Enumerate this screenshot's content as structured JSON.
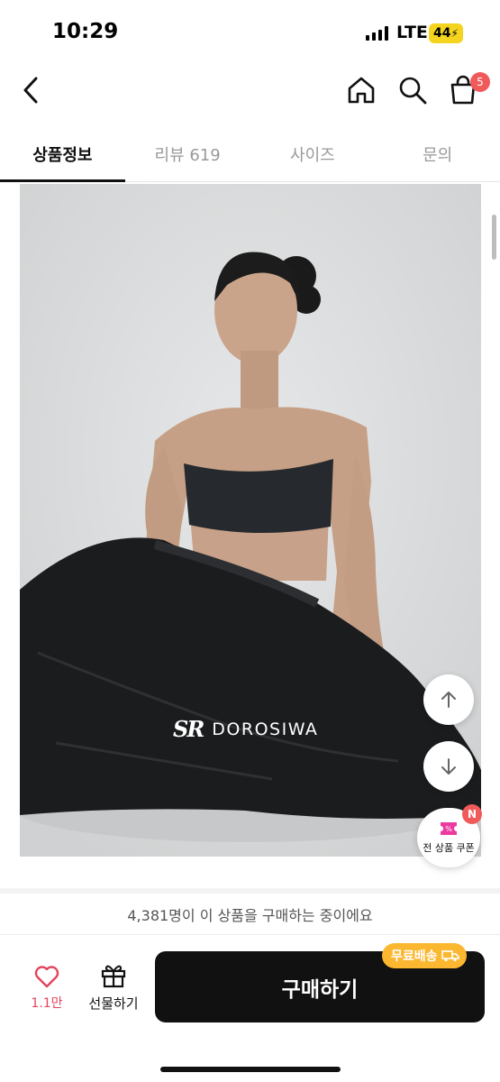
{
  "status_bar": {
    "time": "10:29",
    "network": "LTE",
    "battery": "44"
  },
  "header": {
    "cart_count": "5"
  },
  "tabs": [
    {
      "label": "상품정보",
      "active": true
    },
    {
      "label": "리뷰 619",
      "active": false
    },
    {
      "label": "사이즈",
      "active": false
    },
    {
      "label": "문의",
      "active": false
    }
  ],
  "product_image": {
    "brand_mark": "SR",
    "brand_name": "DOROSIWA"
  },
  "coupon": {
    "label": "전 상품 쿠폰",
    "badge": "N"
  },
  "purchase_info": "4,381명이 이 상품을 구매하는 중이에요",
  "actions": {
    "like_count": "1.1만",
    "gift_label": "선물하기",
    "buy_label": "구매하기",
    "free_shipping_label": "무료배송"
  },
  "colors": {
    "accent_red": "#e2445c",
    "badge_red": "#f05a5a",
    "shipping_orange": "#fbb730",
    "buy_black": "#111111"
  }
}
